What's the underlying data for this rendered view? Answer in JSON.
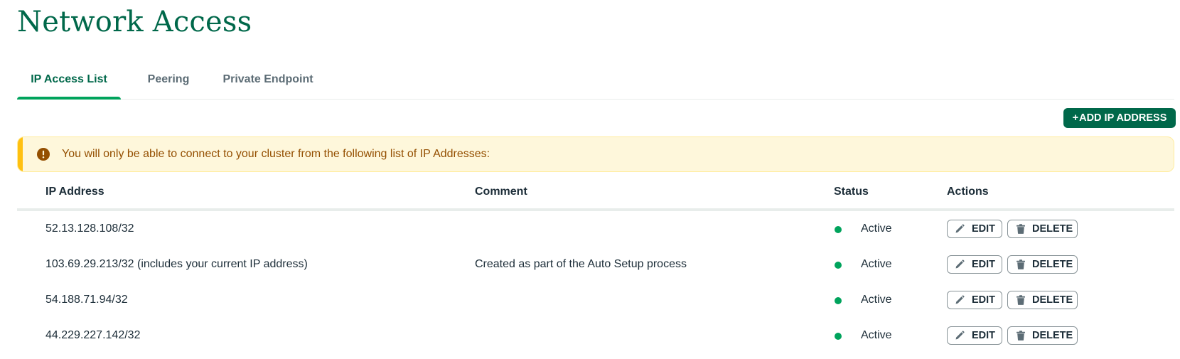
{
  "page": {
    "title": "Network Access"
  },
  "tabs": [
    {
      "label": "IP Access List",
      "active": true
    },
    {
      "label": "Peering",
      "active": false
    },
    {
      "label": "Private Endpoint",
      "active": false
    }
  ],
  "toolbar": {
    "add_plus": "+",
    "add_label": "ADD IP ADDRESS"
  },
  "banner": {
    "icon": "warning-circle-icon",
    "text": "You will only be able to connect to your cluster from the following list of IP Addresses:"
  },
  "table": {
    "headers": {
      "ip": "IP Address",
      "comment": "Comment",
      "status": "Status",
      "actions": "Actions"
    },
    "rows": [
      {
        "ip": "52.13.128.108/32",
        "comment": "",
        "status": "Active",
        "edit": "EDIT",
        "delete": "DELETE"
      },
      {
        "ip": "103.69.29.213/32 (includes your current IP address)",
        "comment": "Created as part of the Auto Setup process",
        "status": "Active",
        "edit": "EDIT",
        "delete": "DELETE"
      },
      {
        "ip": "54.188.71.94/32",
        "comment": "",
        "status": "Active",
        "edit": "EDIT",
        "delete": "DELETE"
      },
      {
        "ip": "44.229.227.142/32",
        "comment": "",
        "status": "Active",
        "edit": "EDIT",
        "delete": "DELETE"
      }
    ]
  },
  "colors": {
    "brand": "#00684a",
    "status_active": "#00a35c",
    "warning_bg": "#fef7db",
    "warning_text": "#944f01"
  }
}
